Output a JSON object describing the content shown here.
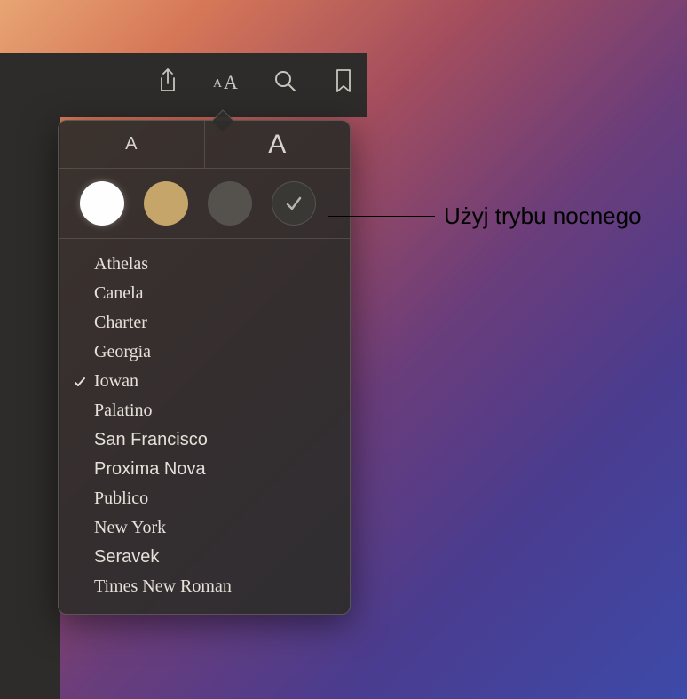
{
  "toolbar": {
    "share_icon": "share-icon",
    "appearance_icon": "appearance-icon",
    "search_icon": "search-icon",
    "bookmark_icon": "bookmark-icon"
  },
  "size": {
    "small": "A",
    "large": "A"
  },
  "themes": [
    {
      "name": "white",
      "color": "#fefefe",
      "selected": false
    },
    {
      "name": "sepia",
      "color": "#c5a56a",
      "selected": false
    },
    {
      "name": "gray",
      "color": "#55524e",
      "selected": false
    },
    {
      "name": "night",
      "color": "#3a3835",
      "selected": true
    }
  ],
  "fonts": [
    {
      "label": "Athelas",
      "selected": false,
      "class": "f-athelas"
    },
    {
      "label": "Canela",
      "selected": false,
      "class": "f-canela"
    },
    {
      "label": "Charter",
      "selected": false,
      "class": "f-charter"
    },
    {
      "label": "Georgia",
      "selected": false,
      "class": "f-georgia"
    },
    {
      "label": "Iowan",
      "selected": true,
      "class": "f-iowan"
    },
    {
      "label": "Palatino",
      "selected": false,
      "class": "f-palatino"
    },
    {
      "label": "San Francisco",
      "selected": false,
      "class": "f-sf"
    },
    {
      "label": "Proxima Nova",
      "selected": false,
      "class": "f-proxima"
    },
    {
      "label": "Publico",
      "selected": false,
      "class": "f-publico"
    },
    {
      "label": "New York",
      "selected": false,
      "class": "f-ny"
    },
    {
      "label": "Seravek",
      "selected": false,
      "class": "f-seravek"
    },
    {
      "label": "Times New Roman",
      "selected": false,
      "class": "f-tnr"
    }
  ],
  "callout": {
    "night_mode": "Użyj trybu nocnego"
  }
}
